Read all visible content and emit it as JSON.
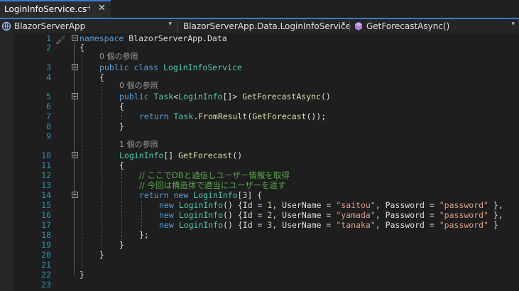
{
  "tab": {
    "title": "LoginInfoService.cs",
    "pin": "⊣",
    "close": "✕"
  },
  "nav": {
    "project": "BlazorServerApp",
    "class": "BlazorServerApp.Data.LoginInfoService",
    "member": "GetForecastAsync()"
  },
  "refs": [
    "0 個の参照",
    "0 個の参照",
    "1 個の参照"
  ],
  "lines": [
    "1",
    "2",
    "3",
    "4",
    "5",
    "6",
    "7",
    "8",
    "9",
    "10",
    "11",
    "12",
    "13",
    "14",
    "15",
    "16",
    "17",
    "18",
    "19",
    "20",
    "21",
    "22",
    "23"
  ],
  "code": {
    "l1_kw": "namespace",
    "l1_name": " BlazorServerApp.Data",
    "brace_open": "{",
    "brace_close": "}",
    "kw_public": "public",
    "kw_class": "class",
    "class_name": "LoginInfoService",
    "type_task": "Task",
    "type_logininfo": "LoginInfo",
    "arr_open": "[",
    "arr_close": "]",
    "lt": "<",
    "gt": ">",
    "method_async": "GetForecastAsync",
    "parens": "()",
    "kw_return": "return",
    "from_result": "FromResult",
    "method_get": "GetForecast",
    "call_tail": "());",
    "comment1": "// ここでDBと通信しユーザー情報を取得",
    "comment2": "// 今回は構造体で適当にユーザーを返す",
    "kw_new": "new",
    "arr_size": "3",
    "brace_semicolon": "};",
    "id_label": "Id = ",
    "username_label": ", UserName = ",
    "password_label": ", Password = ",
    "row1_id": "1",
    "row1_user": "\"saitou\"",
    "row1_pass": "\"password\"",
    "row2_id": "2",
    "row2_user": "\"yamada\"",
    "row2_pass": "\"password\"",
    "row3_id": "3",
    "row3_user": "\"tanaka\"",
    "row3_pass": "\"password\"",
    "dot": ".",
    "space": " ",
    "open_brace_sp": " {",
    "close_brace_comma": " },",
    "close_brace": " }"
  }
}
